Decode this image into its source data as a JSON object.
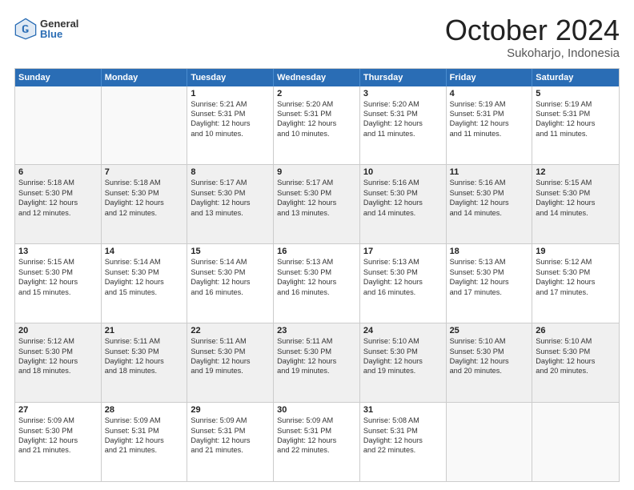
{
  "logo": {
    "general": "General",
    "blue": "Blue"
  },
  "title": "October 2024",
  "subtitle": "Sukoharjo, Indonesia",
  "weekdays": [
    "Sunday",
    "Monday",
    "Tuesday",
    "Wednesday",
    "Thursday",
    "Friday",
    "Saturday"
  ],
  "weeks": [
    [
      {
        "day": "",
        "info": ""
      },
      {
        "day": "",
        "info": ""
      },
      {
        "day": "1",
        "info": "Sunrise: 5:21 AM\nSunset: 5:31 PM\nDaylight: 12 hours\nand 10 minutes."
      },
      {
        "day": "2",
        "info": "Sunrise: 5:20 AM\nSunset: 5:31 PM\nDaylight: 12 hours\nand 10 minutes."
      },
      {
        "day": "3",
        "info": "Sunrise: 5:20 AM\nSunset: 5:31 PM\nDaylight: 12 hours\nand 11 minutes."
      },
      {
        "day": "4",
        "info": "Sunrise: 5:19 AM\nSunset: 5:31 PM\nDaylight: 12 hours\nand 11 minutes."
      },
      {
        "day": "5",
        "info": "Sunrise: 5:19 AM\nSunset: 5:31 PM\nDaylight: 12 hours\nand 11 minutes."
      }
    ],
    [
      {
        "day": "6",
        "info": "Sunrise: 5:18 AM\nSunset: 5:30 PM\nDaylight: 12 hours\nand 12 minutes."
      },
      {
        "day": "7",
        "info": "Sunrise: 5:18 AM\nSunset: 5:30 PM\nDaylight: 12 hours\nand 12 minutes."
      },
      {
        "day": "8",
        "info": "Sunrise: 5:17 AM\nSunset: 5:30 PM\nDaylight: 12 hours\nand 13 minutes."
      },
      {
        "day": "9",
        "info": "Sunrise: 5:17 AM\nSunset: 5:30 PM\nDaylight: 12 hours\nand 13 minutes."
      },
      {
        "day": "10",
        "info": "Sunrise: 5:16 AM\nSunset: 5:30 PM\nDaylight: 12 hours\nand 14 minutes."
      },
      {
        "day": "11",
        "info": "Sunrise: 5:16 AM\nSunset: 5:30 PM\nDaylight: 12 hours\nand 14 minutes."
      },
      {
        "day": "12",
        "info": "Sunrise: 5:15 AM\nSunset: 5:30 PM\nDaylight: 12 hours\nand 14 minutes."
      }
    ],
    [
      {
        "day": "13",
        "info": "Sunrise: 5:15 AM\nSunset: 5:30 PM\nDaylight: 12 hours\nand 15 minutes."
      },
      {
        "day": "14",
        "info": "Sunrise: 5:14 AM\nSunset: 5:30 PM\nDaylight: 12 hours\nand 15 minutes."
      },
      {
        "day": "15",
        "info": "Sunrise: 5:14 AM\nSunset: 5:30 PM\nDaylight: 12 hours\nand 16 minutes."
      },
      {
        "day": "16",
        "info": "Sunrise: 5:13 AM\nSunset: 5:30 PM\nDaylight: 12 hours\nand 16 minutes."
      },
      {
        "day": "17",
        "info": "Sunrise: 5:13 AM\nSunset: 5:30 PM\nDaylight: 12 hours\nand 16 minutes."
      },
      {
        "day": "18",
        "info": "Sunrise: 5:13 AM\nSunset: 5:30 PM\nDaylight: 12 hours\nand 17 minutes."
      },
      {
        "day": "19",
        "info": "Sunrise: 5:12 AM\nSunset: 5:30 PM\nDaylight: 12 hours\nand 17 minutes."
      }
    ],
    [
      {
        "day": "20",
        "info": "Sunrise: 5:12 AM\nSunset: 5:30 PM\nDaylight: 12 hours\nand 18 minutes."
      },
      {
        "day": "21",
        "info": "Sunrise: 5:11 AM\nSunset: 5:30 PM\nDaylight: 12 hours\nand 18 minutes."
      },
      {
        "day": "22",
        "info": "Sunrise: 5:11 AM\nSunset: 5:30 PM\nDaylight: 12 hours\nand 19 minutes."
      },
      {
        "day": "23",
        "info": "Sunrise: 5:11 AM\nSunset: 5:30 PM\nDaylight: 12 hours\nand 19 minutes."
      },
      {
        "day": "24",
        "info": "Sunrise: 5:10 AM\nSunset: 5:30 PM\nDaylight: 12 hours\nand 19 minutes."
      },
      {
        "day": "25",
        "info": "Sunrise: 5:10 AM\nSunset: 5:30 PM\nDaylight: 12 hours\nand 20 minutes."
      },
      {
        "day": "26",
        "info": "Sunrise: 5:10 AM\nSunset: 5:30 PM\nDaylight: 12 hours\nand 20 minutes."
      }
    ],
    [
      {
        "day": "27",
        "info": "Sunrise: 5:09 AM\nSunset: 5:30 PM\nDaylight: 12 hours\nand 21 minutes."
      },
      {
        "day": "28",
        "info": "Sunrise: 5:09 AM\nSunset: 5:31 PM\nDaylight: 12 hours\nand 21 minutes."
      },
      {
        "day": "29",
        "info": "Sunrise: 5:09 AM\nSunset: 5:31 PM\nDaylight: 12 hours\nand 21 minutes."
      },
      {
        "day": "30",
        "info": "Sunrise: 5:09 AM\nSunset: 5:31 PM\nDaylight: 12 hours\nand 22 minutes."
      },
      {
        "day": "31",
        "info": "Sunrise: 5:08 AM\nSunset: 5:31 PM\nDaylight: 12 hours\nand 22 minutes."
      },
      {
        "day": "",
        "info": ""
      },
      {
        "day": "",
        "info": ""
      }
    ]
  ]
}
